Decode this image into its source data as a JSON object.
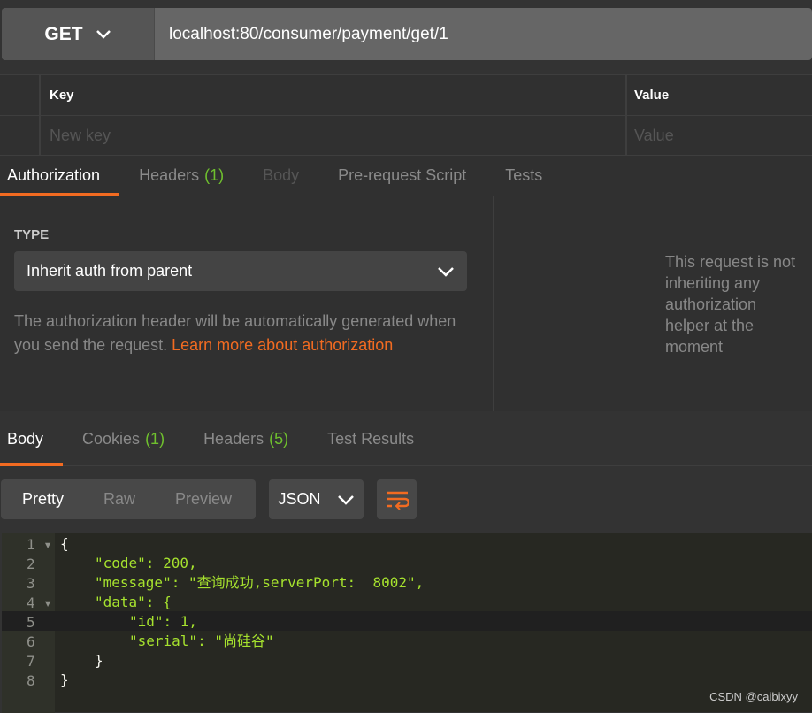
{
  "request": {
    "method": "GET",
    "url": "localhost:80/consumer/payment/get/1"
  },
  "params": {
    "headers": [
      "Key",
      "Value"
    ],
    "placeholders": [
      "New key",
      "Value"
    ]
  },
  "request_tabs": [
    {
      "label": "Authorization",
      "active": true
    },
    {
      "label": "Headers",
      "count": "(1)"
    },
    {
      "label": "Body",
      "disabled": true
    },
    {
      "label": "Pre-request Script"
    },
    {
      "label": "Tests"
    }
  ],
  "auth": {
    "type_label": "TYPE",
    "type_value": "Inherit auth from parent",
    "desc": "The authorization header will be automatically generated when you send the request. ",
    "link": "Learn more about authorization",
    "right_text": "This request is not inheriting any authorization helper at the moment"
  },
  "response_tabs": [
    {
      "label": "Body",
      "active": true
    },
    {
      "label": "Cookies",
      "count": "(1)"
    },
    {
      "label": "Headers",
      "count": "(5)"
    },
    {
      "label": "Test Results"
    }
  ],
  "view": {
    "modes": [
      "Pretty",
      "Raw",
      "Preview"
    ],
    "format": "JSON",
    "wrap_icon": "wrap-lines-icon"
  },
  "code_lines": [
    "{",
    "\"code\": 200,",
    "\"message\": \"查询成功,serverPort:  8002\",",
    "\"data\": {",
    "\"id\": 1,",
    "\"serial\": \"尚硅谷\"",
    "}",
    "}"
  ],
  "watermark": "CSDN @caibixyy",
  "colors": {
    "accent": "#f26b21",
    "count": "#6fc02e",
    "key": "#a6e22e",
    "string": "#e6db74",
    "number": "#ae81ff"
  }
}
